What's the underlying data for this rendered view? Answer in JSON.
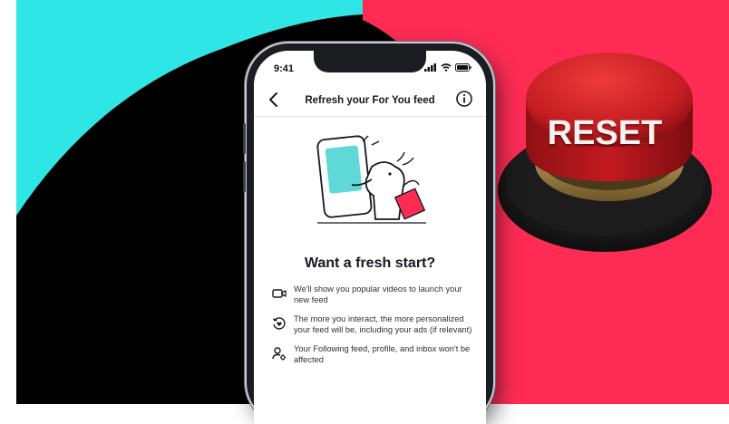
{
  "colors": {
    "cyan": "#2ee6e6",
    "red": "#fe2c55",
    "black": "#000000",
    "reset_red": "#d8232a"
  },
  "status_bar": {
    "time": "9:41"
  },
  "header": {
    "title": "Refresh your For You feed"
  },
  "content": {
    "heading": "Want a fresh start?",
    "items": [
      {
        "icon": "video-camera-icon",
        "text": "We'll show you popular videos to launch your new feed"
      },
      {
        "icon": "heart-refresh-icon",
        "text": "The more you interact, the more personalized your feed will be, including your ads (if relevant)"
      },
      {
        "icon": "user-settings-icon",
        "text": "Your Following feed, profile, and inbox won't be affected"
      }
    ]
  },
  "button": {
    "label": "RESET"
  }
}
